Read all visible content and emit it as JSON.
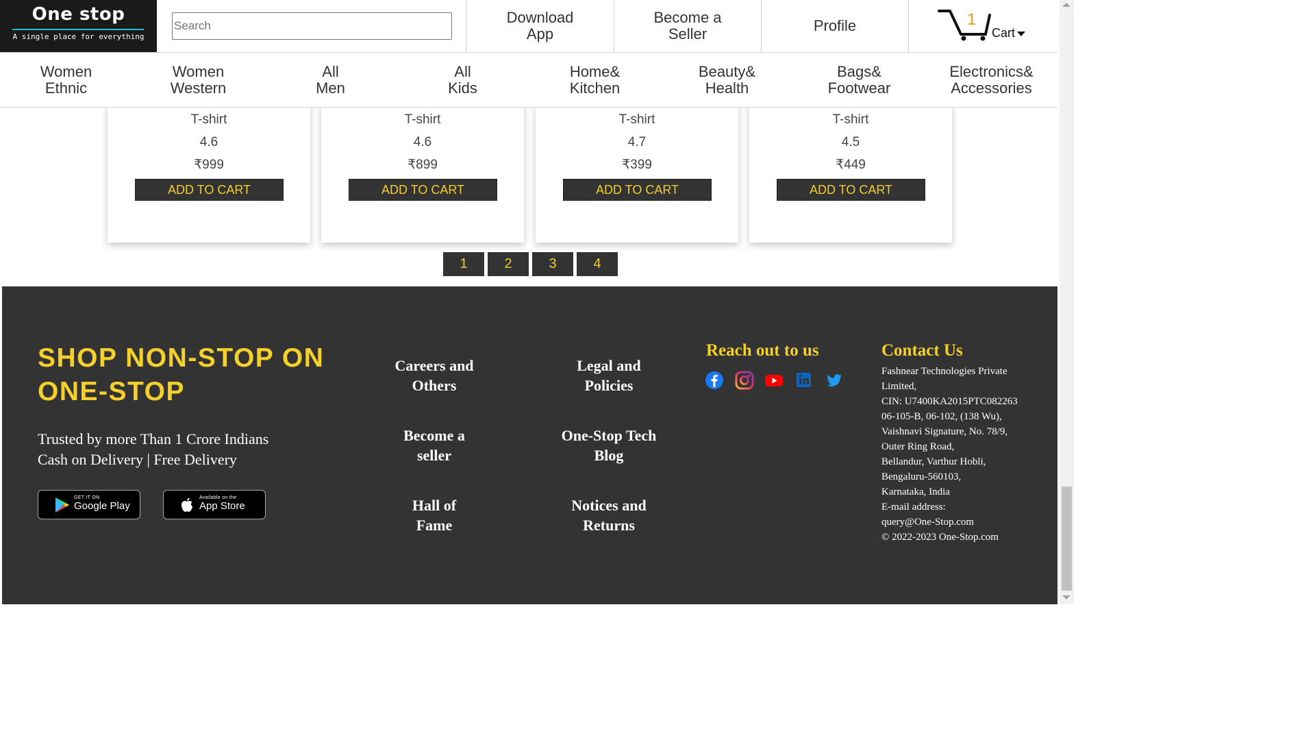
{
  "header": {
    "logo_title": "One stop",
    "logo_tagline": "A single place for everything",
    "search_placeholder": "Search",
    "nav": {
      "download_line1": "Download",
      "download_line2": "App",
      "seller_line1": "Become a",
      "seller_line2": "Seller",
      "profile": "Profile"
    },
    "cart": {
      "count": "1",
      "label": "Cart",
      "icon": "cart-icon"
    }
  },
  "categories": [
    {
      "line1": "Women",
      "line2": "Ethnic"
    },
    {
      "line1": "Women",
      "line2": "Western"
    },
    {
      "line1": "All",
      "line2": "Men"
    },
    {
      "line1": "All",
      "line2": "Kids"
    },
    {
      "line1": "Home&",
      "line2": "Kitchen"
    },
    {
      "line1": "Beauty&",
      "line2": "Health"
    },
    {
      "line1": "Bags&",
      "line2": "Footwear"
    },
    {
      "line1": "Electronics&",
      "line2": "Accessories"
    }
  ],
  "products": [
    {
      "name": "T-shirt",
      "rating": "4.6",
      "price": "₹999",
      "button": "ADD TO CART"
    },
    {
      "name": "T-shirt",
      "rating": "4.6",
      "price": "₹899",
      "button": "ADD TO CART"
    },
    {
      "name": "T-shirt",
      "rating": "4.7",
      "price": "₹399",
      "button": "ADD TO CART"
    },
    {
      "name": "T-shirt",
      "rating": "4.5",
      "price": "₹449",
      "button": "ADD TO CART"
    }
  ],
  "pagination": [
    "1",
    "2",
    "3",
    "4"
  ],
  "footer": {
    "heading": "SHOP NON-STOP ON ONE-STOP",
    "trust_line1": "Trusted by more Than 1 Crore Indians",
    "trust_line2": "Cash on Delivery | Free Delivery",
    "google_play_small": "GET IT ON",
    "google_play_big": "Google Play",
    "app_store_small": "Available on the",
    "app_store_big": "App Store",
    "links": {
      "careers_1": "Careers and",
      "careers_2": "Others",
      "legal_1": "Legal and",
      "legal_2": "Policies",
      "seller_1": "Become a",
      "seller_2": "seller",
      "blog_1": "One-Stop Tech",
      "blog_2": "Blog",
      "fame_1": "Hall of",
      "fame_2": "Fame",
      "notices_1": "Notices and",
      "notices_2": "Returns"
    },
    "reach_heading": "Reach out to us",
    "social_icons": [
      "facebook-icon",
      "instagram-icon",
      "youtube-icon",
      "linkedin-icon",
      "twitter-icon"
    ],
    "contact_heading": "Contact Us",
    "contact_lines": [
      "Fashnear Technologies Private",
      "Limited,",
      "CIN: U7400KA2015PTC082263",
      "06-105-B, 06-102, (138 Wu),",
      "Vaishnavi Signature, No. 78/9,",
      "Outer Ring Road,",
      "Bellandur, Varthur Hobli,",
      "Bengaluru-560103,",
      "Karnataka, India",
      "E-mail address:",
      "query@One-Stop.com",
      "© 2022-2023 One-Stop.com"
    ]
  },
  "colors": {
    "accent_yellow": "#f2cc2a",
    "footer_bg": "#333333",
    "logo_bg": "#1a1a1a",
    "logo_underline": "#18c8d0",
    "cart_count": "#e8a020"
  }
}
